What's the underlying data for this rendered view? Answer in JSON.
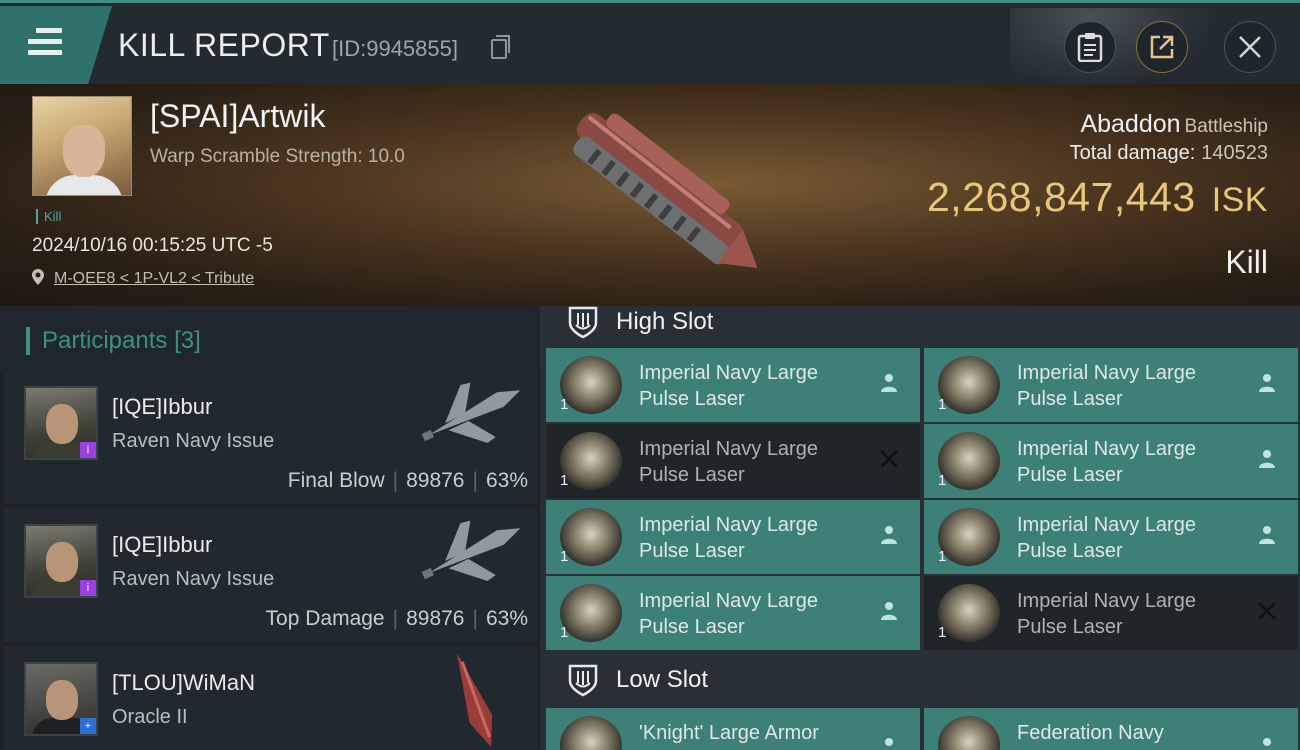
{
  "header": {
    "title": "KILL REPORT",
    "report_id": "[ID:9945855]"
  },
  "victim": {
    "name": "[SPAI]Artwik",
    "warp_scramble": "Warp Scramble Strength: 10.0",
    "tag": "Kill",
    "timestamp": "2024/10/16 00:15:25 UTC -5",
    "location": "M-OEE8 < 1P-VL2 < Tribute",
    "ship": "Abaddon",
    "ship_class": "Battleship",
    "total_damage_label": "Total damage:",
    "total_damage": "140523",
    "isk_value": "2,268,847,443",
    "isk_unit": "ISK",
    "result": "Kill"
  },
  "participants": {
    "label": "Participants",
    "count": "[3]",
    "rows": [
      {
        "name": "[IQE]Ibbur",
        "ship": "Raven Navy Issue",
        "role": "Final Blow",
        "damage": "89876",
        "percent": "63%"
      },
      {
        "name": "[IQE]Ibbur",
        "ship": "Raven Navy Issue",
        "role": "Top Damage",
        "damage": "89876",
        "percent": "63%"
      },
      {
        "name": "[TLOU]WiMaN",
        "ship": "Oracle II",
        "role": "",
        "damage": "",
        "percent": ""
      }
    ]
  },
  "fitting": {
    "high_slot_label": "High Slot",
    "low_slot_label": "Low Slot",
    "high_slot": [
      {
        "line1": "Imperial Navy Large",
        "line2": "Pulse Laser",
        "qty": "1",
        "state": "dropped"
      },
      {
        "line1": "Imperial Navy Large",
        "line2": "Pulse Laser",
        "qty": "1",
        "state": "dropped"
      },
      {
        "line1": "Imperial Navy Large",
        "line2": "Pulse Laser",
        "qty": "1",
        "state": "destroyed"
      },
      {
        "line1": "Imperial Navy Large",
        "line2": "Pulse Laser",
        "qty": "1",
        "state": "dropped"
      },
      {
        "line1": "Imperial Navy Large",
        "line2": "Pulse Laser",
        "qty": "1",
        "state": "dropped"
      },
      {
        "line1": "Imperial Navy Large",
        "line2": "Pulse Laser",
        "qty": "1",
        "state": "dropped"
      },
      {
        "line1": "Imperial Navy Large",
        "line2": "Pulse Laser",
        "qty": "1",
        "state": "dropped"
      },
      {
        "line1": "Imperial Navy Large",
        "line2": "Pulse Laser",
        "qty": "1",
        "state": "destroyed"
      }
    ],
    "low_slot": [
      {
        "line1": "'Knight' Large Armor",
        "line2": "",
        "qty": "",
        "state": "dropped"
      },
      {
        "line1": "Federation Navy",
        "line2": "",
        "qty": "",
        "state": "dropped"
      }
    ]
  },
  "colors": {
    "accent": "#3e8f86",
    "isk": "#e8c67a",
    "module_dropped": "#3d8078",
    "module_destroyed": "#1f2529"
  }
}
